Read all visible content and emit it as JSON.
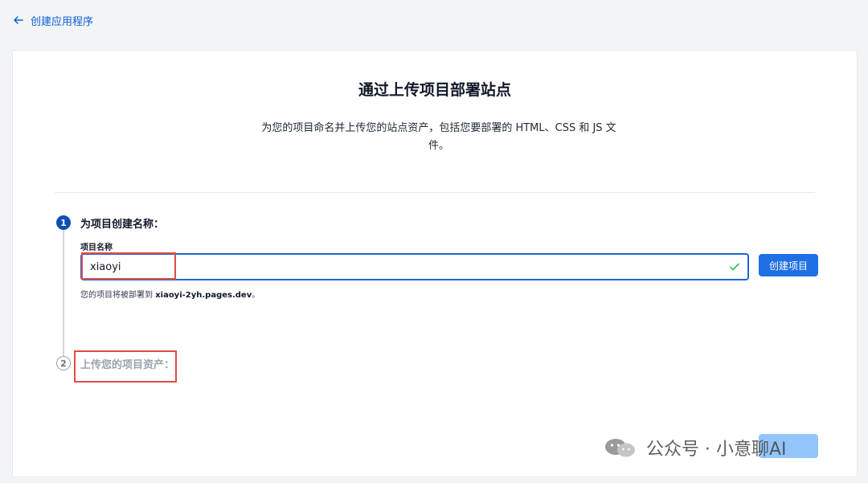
{
  "topbar": {
    "back_label": "创建应用程序",
    "back_icon": "arrow-left-icon"
  },
  "header": {
    "title": "通过上传项目部署站点",
    "subtitle": "为您的项目命名并上传您的站点资产，包括您要部署的 HTML、CSS 和 JS 文件。"
  },
  "steps": [
    {
      "number": "1",
      "label": "为项目创建名称：",
      "field_label": "项目名称",
      "input_value": "xiaoyi",
      "button_label": "创建项目",
      "deploy_prefix": "您的项目将被部署到 ",
      "deploy_domain": "xiaoyi-2yh.pages.dev",
      "deploy_suffix": "。"
    },
    {
      "number": "2",
      "label": "上传您的项目资产："
    }
  ],
  "watermark": {
    "text": "公众号 · 小意聊AI"
  },
  "colors": {
    "accent": "#1f6fe5",
    "accent_dark": "#0b4fb3",
    "highlight": "#e24a4a",
    "check": "#22c55e"
  }
}
